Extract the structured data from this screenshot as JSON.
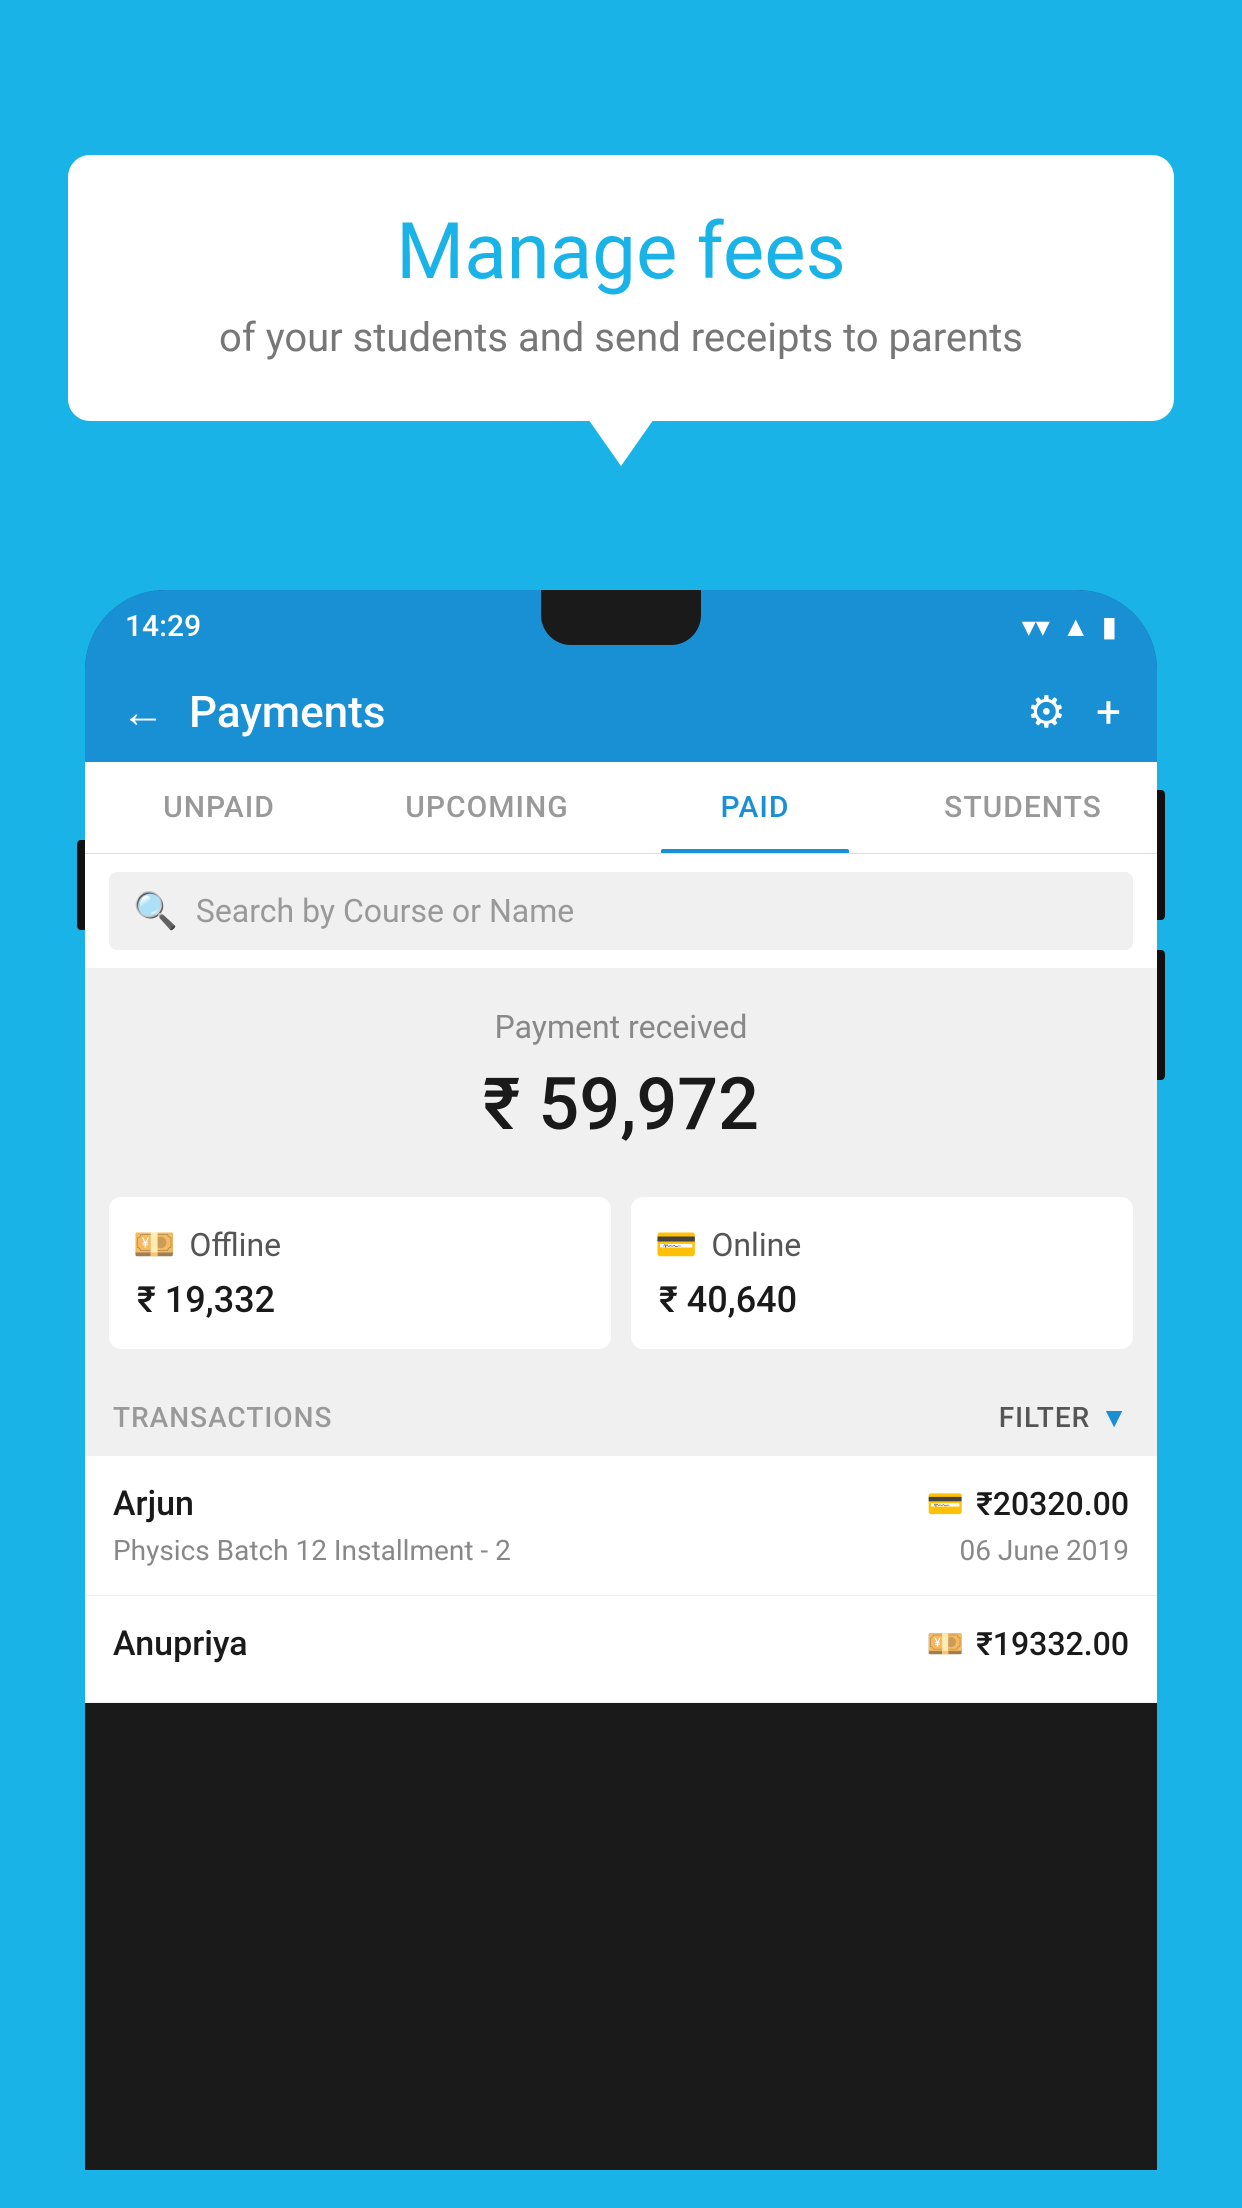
{
  "background_color": "#1ab3e8",
  "bubble": {
    "title": "Manage fees",
    "subtitle": "of your students and send receipts to parents"
  },
  "status_bar": {
    "time": "14:29",
    "wifi_symbol": "▼",
    "signal_symbol": "▲",
    "battery_symbol": "▮"
  },
  "header": {
    "title": "Payments",
    "back_icon": "←",
    "gear_icon": "⚙",
    "plus_icon": "+"
  },
  "tabs": [
    {
      "label": "UNPAID",
      "active": false
    },
    {
      "label": "UPCOMING",
      "active": false
    },
    {
      "label": "PAID",
      "active": true
    },
    {
      "label": "STUDENTS",
      "active": false
    }
  ],
  "search": {
    "placeholder": "Search by Course or Name",
    "icon": "🔍"
  },
  "payment_summary": {
    "label": "Payment received",
    "total_amount": "₹ 59,972",
    "offline": {
      "label": "Offline",
      "amount": "₹ 19,332",
      "icon": "💴"
    },
    "online": {
      "label": "Online",
      "amount": "₹ 40,640",
      "icon": "💳"
    }
  },
  "transactions": {
    "label": "TRANSACTIONS",
    "filter_label": "FILTER",
    "items": [
      {
        "name": "Arjun",
        "course": "Physics Batch 12 Installment - 2",
        "amount": "₹20320.00",
        "date": "06 June 2019",
        "icon": "💳"
      },
      {
        "name": "Anupriya",
        "course": "",
        "amount": "₹19332.00",
        "date": "",
        "icon": "💴"
      }
    ]
  }
}
